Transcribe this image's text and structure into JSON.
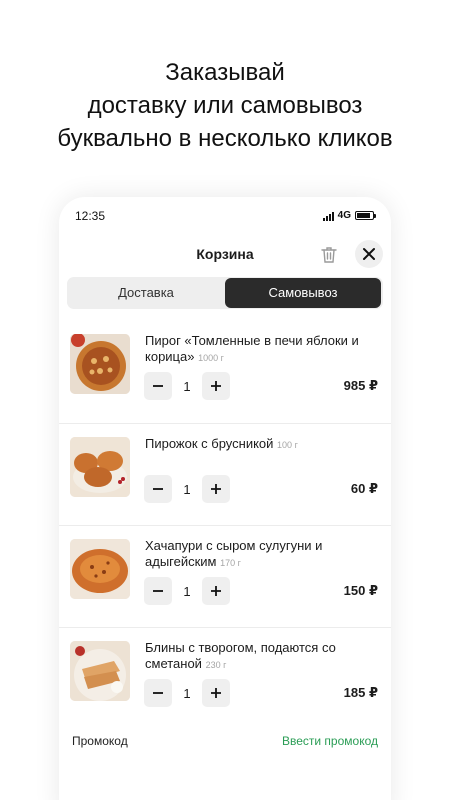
{
  "headline": {
    "line1": "Заказывай",
    "line2": "доставку или самовывоз",
    "line3": "буквально в несколько кликов"
  },
  "status_bar": {
    "time": "12:35",
    "network": "4G",
    "battery_level": 0.85
  },
  "header": {
    "title": "Корзина",
    "icons": {
      "delete": "trash-icon",
      "close": "close-icon"
    }
  },
  "tabs": [
    {
      "label": "Доставка",
      "selected": false
    },
    {
      "label": "Самовывоз",
      "selected": true
    }
  ],
  "cart_items": [
    {
      "name": "Пирог «Томленные в печи яблоки и корица»",
      "weight": "1000 г",
      "quantity": "1",
      "price": "985 ₽"
    },
    {
      "name": "Пирожок с брусникой",
      "weight": "100 г",
      "quantity": "1",
      "price": "60 ₽"
    },
    {
      "name": "Хачапури с сыром сулугуни и адыгейским",
      "weight": "170 г",
      "quantity": "1",
      "price": "150 ₽"
    },
    {
      "name": "Блины с творогом, подаются со сметаной",
      "weight": "230 г",
      "quantity": "1",
      "price": "185 ₽"
    }
  ],
  "promo": {
    "label": "Промокод",
    "action": "Ввести промокод"
  },
  "colors": {
    "accent_green": "#2a9d55",
    "selected_tab": "#2b2b2b",
    "button_bg": "#efefef"
  }
}
